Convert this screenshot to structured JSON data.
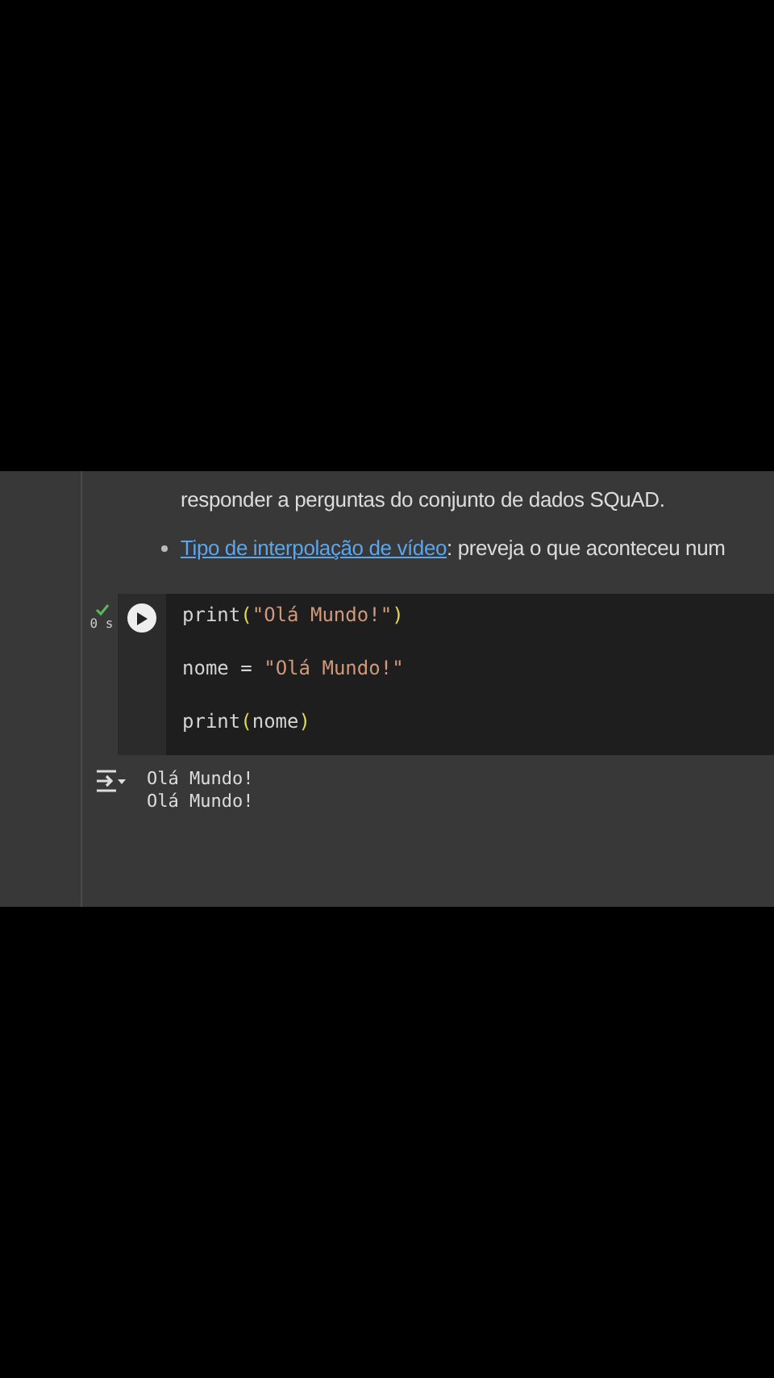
{
  "text_cell": {
    "continuation": "responder a perguntas do conjunto de dados SQuAD.",
    "bullets": [
      {
        "link": "Tipo de interpolação de vídeo",
        "text": ": preveja o que aconteceu num"
      }
    ]
  },
  "code_cell": {
    "executed": true,
    "time": "0 s",
    "lines": [
      [
        {
          "text": "print",
          "kind": "plain"
        },
        {
          "text": "(",
          "kind": "paren"
        },
        {
          "text": "\"Olá Mundo!\"",
          "kind": "string"
        },
        {
          "text": ")",
          "kind": "paren"
        }
      ],
      [
        {
          "text": "nome",
          "kind": "plain"
        },
        {
          "text": " = ",
          "kind": "plain"
        },
        {
          "text": "\"Olá Mundo!\"",
          "kind": "string"
        }
      ],
      [
        {
          "text": "print",
          "kind": "plain"
        },
        {
          "text": "(",
          "kind": "paren"
        },
        {
          "text": "nome",
          "kind": "plain"
        },
        {
          "text": ")",
          "kind": "paren"
        }
      ]
    ]
  },
  "output": [
    "Olá Mundo!",
    "Olá Mundo!"
  ]
}
